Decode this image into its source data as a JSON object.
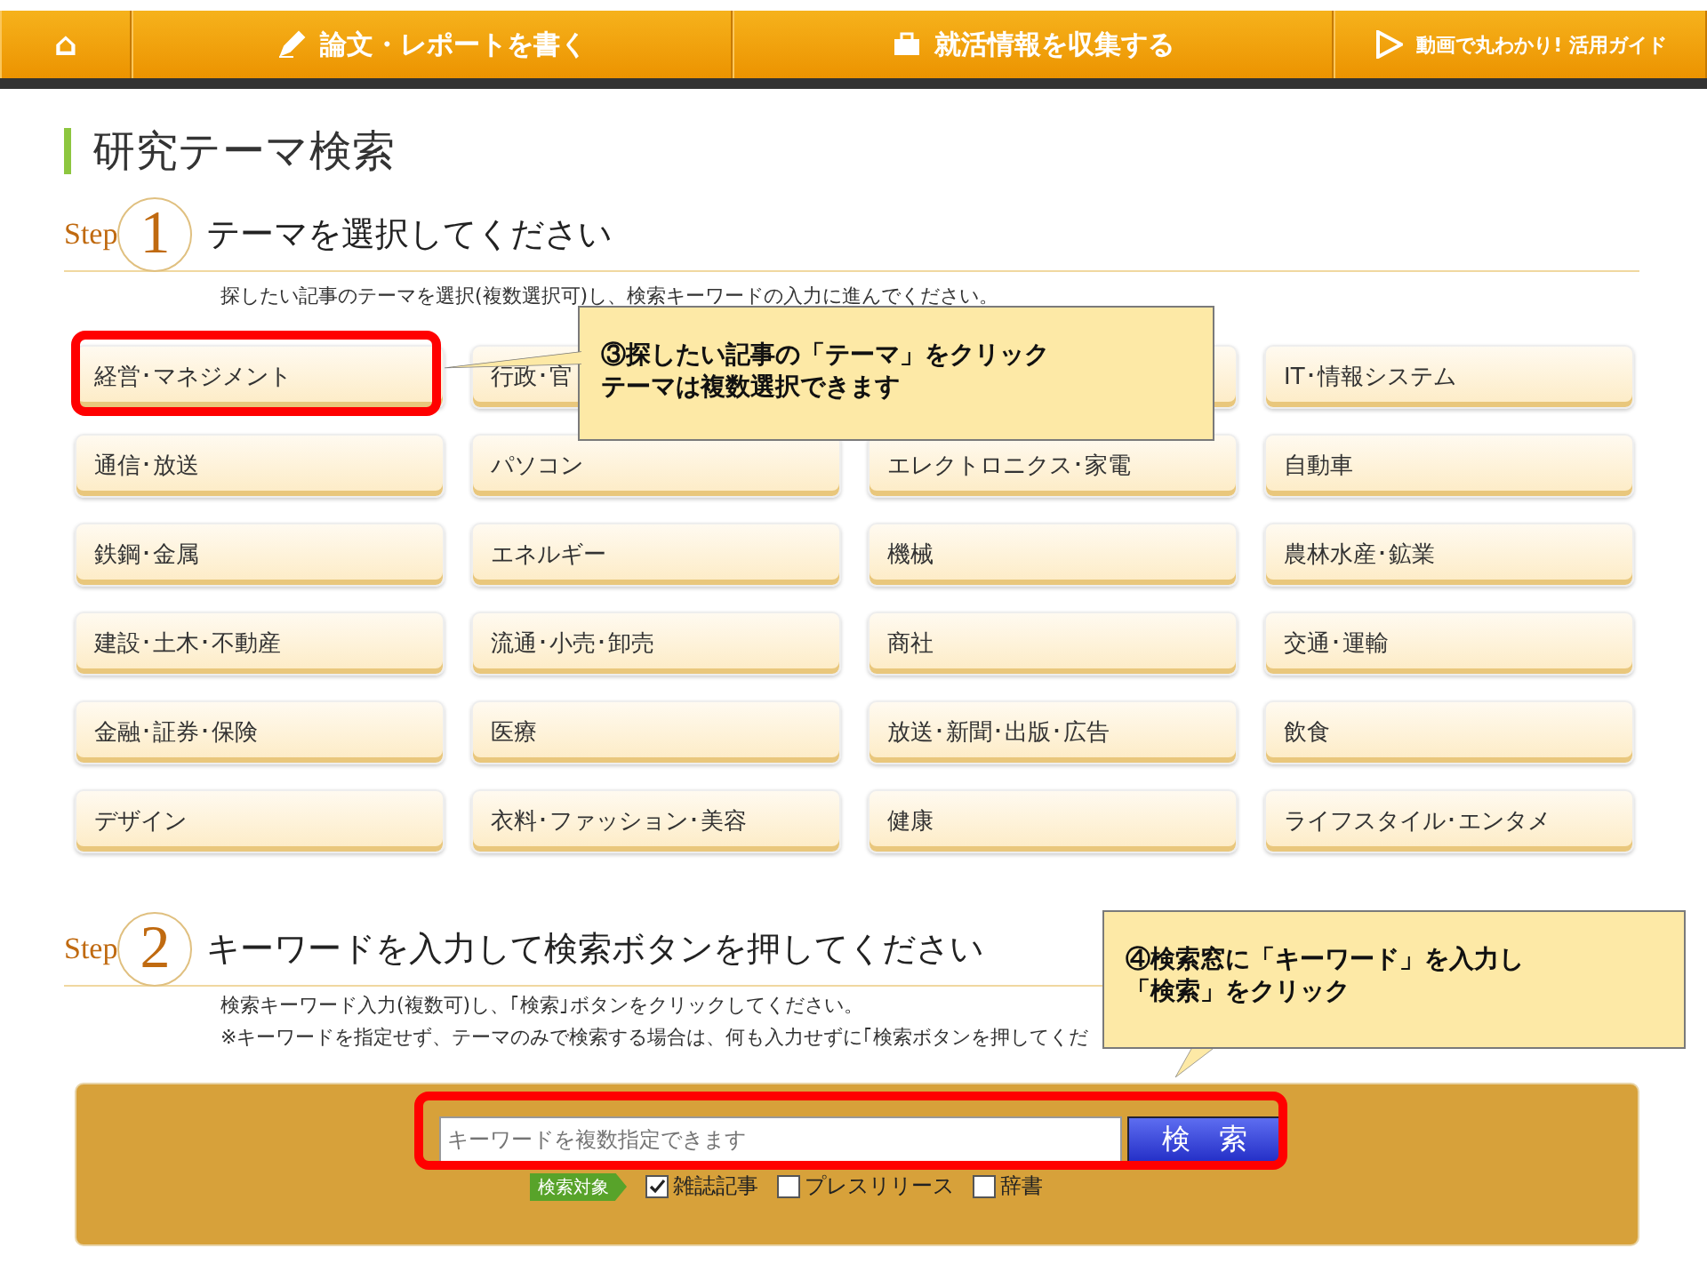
{
  "nav": [
    {
      "kind": "home",
      "label": "⌂"
    },
    {
      "kind": "pen",
      "label": "論文・レポートを書く"
    },
    {
      "kind": "bag",
      "label": "就活情報を収集する"
    },
    {
      "kind": "video",
      "label": "動画で丸わかり! 活用ガイド"
    }
  ],
  "title": "研究テーマ検索",
  "step1": {
    "step": "Step",
    "number": "1",
    "heading": "テーマを選択してください",
    "note": "探したい記事のテーマを選択(複数選択可)し、検索キーワードの入力に進んでください。"
  },
  "themes": [
    {
      "label": "経営･マネジメント",
      "selected": false
    },
    {
      "label": "行政･官",
      "selected": false
    },
    {
      "selected": false
    },
    {
      "label": "IT･情報システム",
      "selected": false
    },
    {
      "label": "通信･放送",
      "selected": false
    },
    {
      "label": "パソコン",
      "selected": false
    },
    {
      "label": "エレクトロニクス･家電",
      "selected": false
    },
    {
      "label": "自動車",
      "selected": false
    },
    {
      "label": "鉄鋼･金属",
      "selected": false
    },
    {
      "label": "エネルギー",
      "selected": false
    },
    {
      "label": "機械",
      "selected": false
    },
    {
      "label": "農林水産･鉱業",
      "selected": false
    },
    {
      "label": "建設･土木･不動産",
      "selected": false
    },
    {
      "label": "流通･小売･卸売",
      "selected": false
    },
    {
      "label": "商社",
      "selected": false
    },
    {
      "label": "交通･運輸",
      "selected": false
    },
    {
      "label": "金融･証券･保険",
      "selected": false
    },
    {
      "label": "医療",
      "selected": false
    },
    {
      "label": "放送･新聞･出版･広告",
      "selected": false
    },
    {
      "label": "飲食",
      "selected": false
    },
    {
      "label": "デザイン",
      "selected": false
    },
    {
      "label": "衣料･ファッション･美容",
      "selected": false
    },
    {
      "label": "健康",
      "selected": false
    },
    {
      "label": "ライフスタイル･エンタメ",
      "selected": false
    }
  ],
  "step2": {
    "step": "Step",
    "number": "2",
    "heading": "キーワードを入力して検索ボタンを押してください",
    "notes": [
      "検索キーワード入力(複数可)し、｢検索｣ボタンをクリックしてください。",
      "※キーワードを指定せず、テーマのみで検索する場合は、何も入力せずに｢検索ボタンを押してくだ"
    ]
  },
  "search": {
    "placeholder": "キーワードを複数指定できます",
    "button": "検　索",
    "target_label": "検索対象",
    "targets": [
      {
        "label": "雑誌記事",
        "checked": true
      },
      {
        "label": "プレスリリース",
        "checked": false
      },
      {
        "label": "辞書",
        "checked": false
      }
    ]
  },
  "callouts": [
    {
      "lines": [
        "③探したい記事の「テーマ」をクリック",
        "テーマは複数選択できます"
      ]
    },
    {
      "lines": [
        "④検索窓に「キーワード」を入力し",
        "「検索」をクリック"
      ]
    }
  ]
}
